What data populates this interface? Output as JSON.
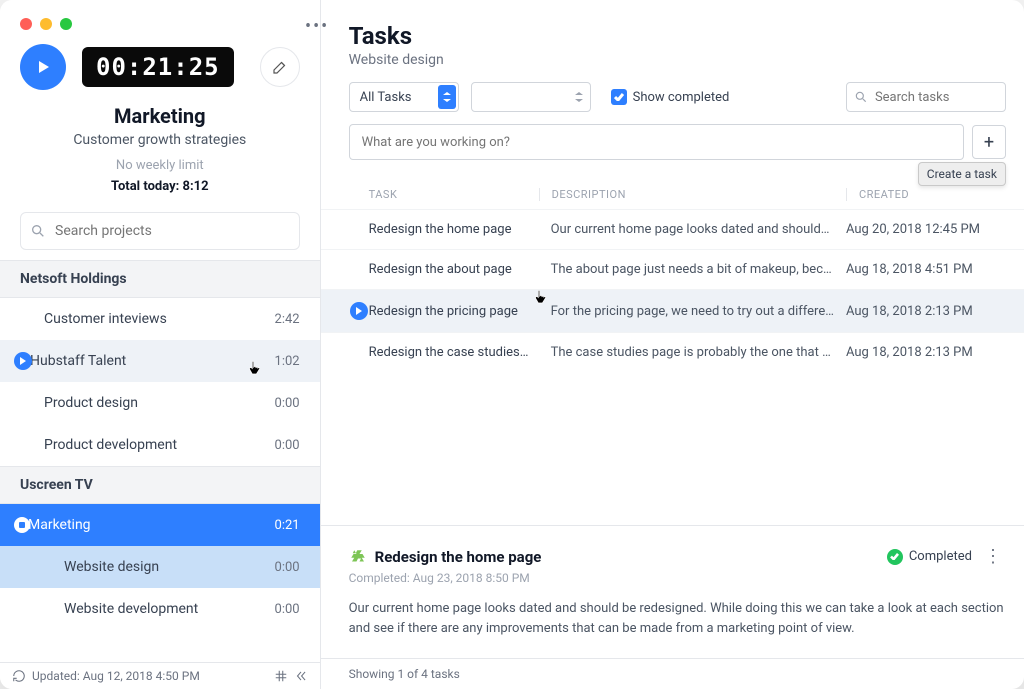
{
  "timer": {
    "value": "00:21:25",
    "project_name": "Marketing",
    "project_sub": "Customer growth strategies",
    "limit": "No weekly limit",
    "total_today": "Total today: 8:12"
  },
  "sidebar": {
    "search_placeholder": "Search projects",
    "groups": [
      {
        "name": "Netsoft Holdings",
        "projects": [
          {
            "name": "Customer inteviews",
            "time": "2:42"
          },
          {
            "name": "Hubstaff Talent",
            "time": "1:02",
            "tracking": true
          },
          {
            "name": "Product design",
            "time": "0:00"
          },
          {
            "name": "Product development",
            "time": "0:00"
          }
        ]
      },
      {
        "name": "Uscreen TV",
        "projects": [
          {
            "name": "Marketing",
            "time": "0:21",
            "active": true
          },
          {
            "name": "Website design",
            "time": "0:00",
            "child": true,
            "lit": true
          },
          {
            "name": "Website development",
            "time": "0:00",
            "child": true
          }
        ]
      }
    ],
    "status": "Updated: Aug 12, 2018 4:50 PM"
  },
  "main": {
    "title": "Tasks",
    "subtitle": "Website design",
    "filter_select": "All Tasks",
    "show_completed_label": "Show completed",
    "search_placeholder": "Search tasks",
    "newtask_placeholder": "What are you working on?",
    "newtask_tooltip": "Create a task",
    "columns": {
      "task": "TASK",
      "desc": "DESCRIPTION",
      "created": "CREATED"
    },
    "tasks": [
      {
        "name": "Redesign the home page",
        "desc": "Our current home page looks dated and should…",
        "created": "Aug 20, 2018 12:45 PM"
      },
      {
        "name": "Redesign the about page",
        "desc": "The about page just needs a bit of makeup, bec…",
        "created": "Aug 18, 2018 4:51 PM"
      },
      {
        "name": "Redesign the pricing page",
        "desc": "For the pricing page, we need to try out a differe…",
        "created": "Aug 18, 2018 2:13 PM",
        "selected": true
      },
      {
        "name": "Redesign the case studies pa…",
        "desc": "The case studies page is probably the one that …",
        "created": "Aug 18, 2018 2:13 PM"
      }
    ],
    "detail": {
      "title": "Redesign the home page",
      "completed_label": "Completed",
      "completed_sub": "Completed: Aug 23, 2018 8:50 PM",
      "body": "Our current home page looks dated and should be redesigned. While doing this we can take a look at each section and see if there are any improvements that can be made from a marketing point of view."
    },
    "footer": "Showing 1 of 4 tasks"
  }
}
